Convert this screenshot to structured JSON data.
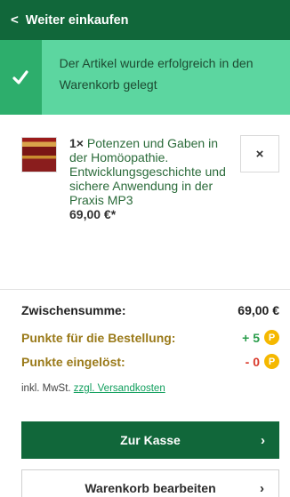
{
  "header": {
    "back_label": "Weiter einkaufen",
    "back_icon": "chevron-left-icon"
  },
  "notice": {
    "message": "Der Artikel wurde erfolgreich in den Warenkorb gelegt",
    "icon": "check-icon"
  },
  "item": {
    "quantity": "1×",
    "title": "Potenzen und Gaben in der Homöopathie. Entwicklungsgeschichte und sichere Anwendung in der Praxis MP3",
    "price": "69,00 €*",
    "remove_label": "×"
  },
  "summary": {
    "subtotal_label": "Zwischensumme:",
    "subtotal_value": "69,00 €",
    "points_label": "Punkte für die Bestellung:",
    "points_value": "+ 5",
    "points_used_label": "Punkte eingelöst:",
    "points_used_value": "- 0",
    "coin_label": "P",
    "tax_text": "inkl. MwSt.",
    "shipping_link": "zzgl. Versandkosten"
  },
  "actions": {
    "checkout_label": "Zur Kasse",
    "checkout_arrow": "›",
    "edit_label": "Warenkorb bearbeiten",
    "edit_arrow": "›"
  },
  "colors": {
    "brand": "#11673a",
    "success": "#5cd6a0",
    "points": "#9a7a1a",
    "link": "#0f9e5c",
    "coin": "#f5b800"
  }
}
